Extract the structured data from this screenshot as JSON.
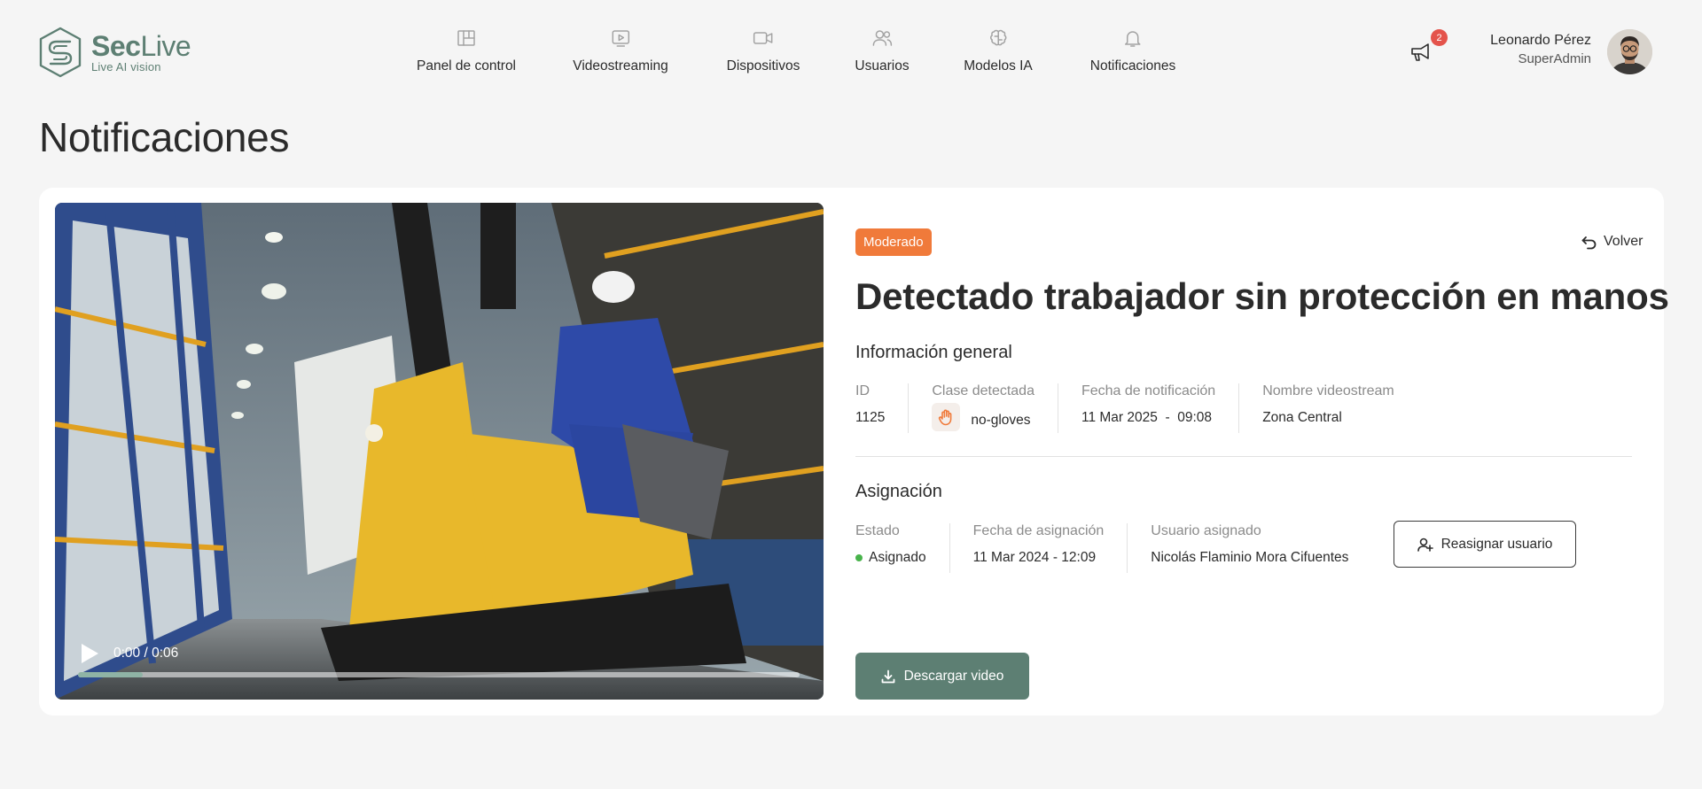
{
  "brand": {
    "name_bold": "Sec",
    "name_light": "Live",
    "tagline": "Live AI vision"
  },
  "nav": {
    "items": [
      {
        "label": "Panel de control",
        "icon": "dashboard-icon"
      },
      {
        "label": "Videostreaming",
        "icon": "video-play-icon"
      },
      {
        "label": "Dispositivos",
        "icon": "camera-icon"
      },
      {
        "label": "Usuarios",
        "icon": "users-icon"
      },
      {
        "label": "Modelos IA",
        "icon": "brain-icon"
      },
      {
        "label": "Notificaciones",
        "icon": "bell-icon"
      }
    ]
  },
  "header": {
    "announcement_count": "2",
    "user_name": "Leonardo Pérez",
    "user_role": "SuperAdmin"
  },
  "page": {
    "title": "Notificaciones"
  },
  "video": {
    "time": "0:00 / 0:06",
    "progress": 0.09
  },
  "notification": {
    "severity": "Moderado",
    "back_label": "Volver",
    "headline": "Detectado trabajador sin protección en manos",
    "general": {
      "title": "Información general",
      "fields": [
        {
          "label": "ID",
          "value": "1125"
        },
        {
          "label": "Clase detectada",
          "value": "no-gloves"
        },
        {
          "label": "Fecha de notificación",
          "value": "11 Mar 2025  -  09:08"
        },
        {
          "label": "Nombre videostream",
          "value": "Zona Central"
        }
      ]
    },
    "assignment": {
      "title": "Asignación",
      "fields": [
        {
          "label": "Estado",
          "value": "Asignado"
        },
        {
          "label": "Fecha de asignación",
          "value": "11 Mar 2024 - 12:09"
        },
        {
          "label": "Usuario asignado",
          "value": "Nicolás Flaminio Mora Cifuentes"
        }
      ],
      "reassign_label": "Reasignar usuario"
    },
    "download_label": "Descargar video"
  },
  "colors": {
    "brand": "#5d7f73",
    "severity": "#f07a3a",
    "badge": "#e4534b",
    "status_dot": "#48b34b"
  }
}
